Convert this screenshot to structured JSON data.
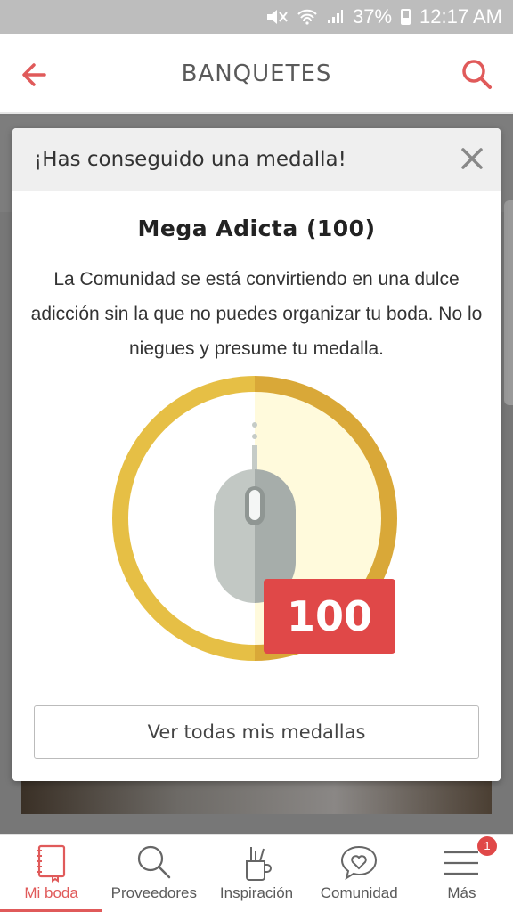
{
  "status_bar": {
    "battery": "37%",
    "time": "12:17 AM"
  },
  "header": {
    "title": "BANQUETES"
  },
  "modal": {
    "title": "¡Has conseguido una medalla!",
    "medal_name": "Mega Adicta (100)",
    "description": "La Comunidad se está convirtiendo en una dulce adicción sin la que no puedes organizar tu boda. No lo niegues y presume tu medalla.",
    "badge_count": "100",
    "view_all_button": "Ver todas mis medallas"
  },
  "bottom_nav": {
    "items": [
      {
        "label": "Mi boda",
        "icon": "notebook-icon"
      },
      {
        "label": "Proveedores",
        "icon": "search-icon"
      },
      {
        "label": "Inspiración",
        "icon": "pencil-cup-icon"
      },
      {
        "label": "Comunidad",
        "icon": "heart-chat-icon"
      },
      {
        "label": "Más",
        "icon": "menu-icon"
      }
    ],
    "notification_count": "1"
  },
  "colors": {
    "accent": "#e05a5a",
    "medal_gold": "#e6b93a",
    "medal_cream": "#fffadf",
    "mouse_gray": "#bcc2be",
    "badge_red": "#e04848"
  }
}
